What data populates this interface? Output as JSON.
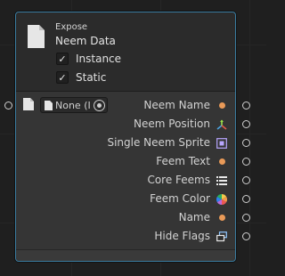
{
  "node": {
    "kind": "Expose",
    "title": "Neem Data",
    "toggles": [
      {
        "label": "Instance",
        "checked": true
      },
      {
        "label": "Static",
        "checked": true
      }
    ],
    "input": {
      "field_value": "None (I",
      "picker_icon": "object-picker-icon"
    },
    "outputs": [
      {
        "label": "Neem Name",
        "icon": "orange-dot-icon"
      },
      {
        "label": "Neem Position",
        "icon": "transform-axes-icon"
      },
      {
        "label": "Single Neem Sprite",
        "icon": "sprite-icon"
      },
      {
        "label": "Feem Text",
        "icon": "orange-dot-icon"
      },
      {
        "label": "Core Feems",
        "icon": "list-icon"
      },
      {
        "label": "Feem Color",
        "icon": "color-wheel-icon"
      },
      {
        "label": "Name",
        "icon": "orange-dot-icon"
      },
      {
        "label": "Hide Flags",
        "icon": "flags-icon"
      }
    ]
  },
  "colors": {
    "accent_border": "#3a7ca0",
    "string_dot": "#e99a58",
    "node_bg": "#2f2f2f"
  }
}
